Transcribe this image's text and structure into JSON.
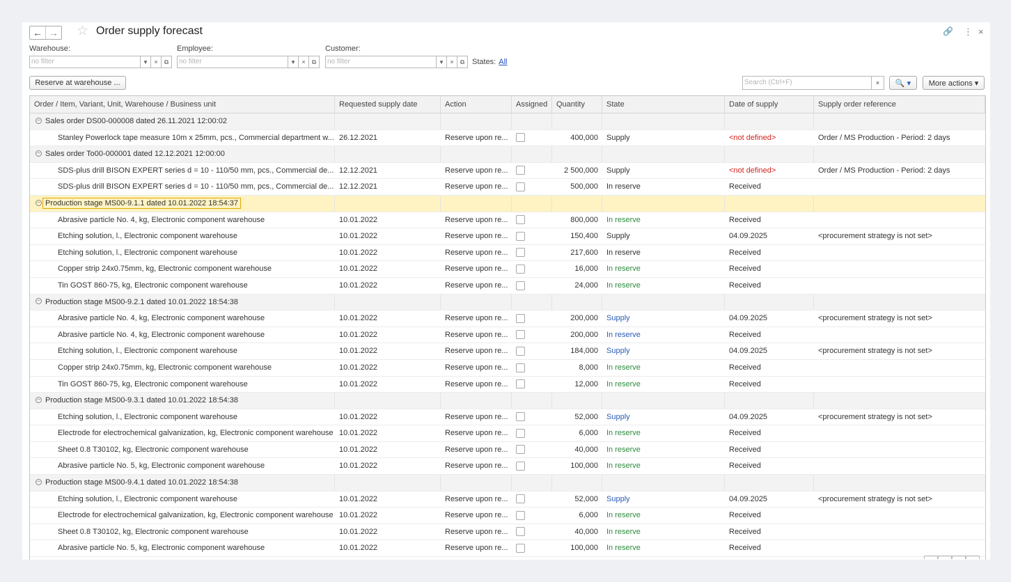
{
  "window": {
    "title": "Order supply forecast",
    "back_glyph": "←",
    "forward_glyph": "→",
    "star_glyph": "☆",
    "link_glyph": "🔗",
    "more_glyph": "⋮",
    "close_glyph": "×"
  },
  "filters": {
    "warehouse": {
      "label": "Warehouse:",
      "placeholder": "no filter"
    },
    "employee": {
      "label": "Employee:",
      "placeholder": "no filter"
    },
    "customer": {
      "label": "Customer:",
      "placeholder": "no filter"
    },
    "dropdown_glyph": "▾",
    "clear_glyph": "×",
    "open_glyph": "⧉",
    "states_label": "States:",
    "states_value": "All"
  },
  "toolbar": {
    "reserve_button": "Reserve at warehouse ...",
    "search_placeholder": "Search (Ctrl+F)",
    "search_clear": "×",
    "search_button": "🔍 ▾",
    "more_actions": "More actions ▾"
  },
  "columns": [
    "Order / Item, Variant, Unit, Warehouse / Business unit",
    "Requested supply date",
    "Action",
    "Assigned",
    "Quantity",
    "State",
    "Date of supply",
    "Supply order reference"
  ],
  "groups": [
    {
      "title": "Sales order DS00-000008 dated 26.11.2021 12:00:02",
      "selected": false,
      "rows": [
        {
          "item": "Stanley Powerlock tape measure 10m x 25mm, pcs., Commercial department w...",
          "date": "26.12.2021",
          "action": "Reserve upon re...",
          "qty": "400,000",
          "state": "Supply",
          "state_style": "def",
          "supply_date": "<not defined>",
          "supply_red": true,
          "ref": "Order / MS Production - Period: 2 days"
        }
      ]
    },
    {
      "title": "Sales order To00-000001 dated 12.12.2021 12:00:00",
      "selected": false,
      "rows": [
        {
          "item": "SDS-plus drill BISON EXPERT series d = 10 - 110/50 mm, pcs., Commercial de...",
          "date": "12.12.2021",
          "action": "Reserve upon re...",
          "qty": "2 500,000",
          "state": "Supply",
          "state_style": "def",
          "supply_date": "<not defined>",
          "supply_red": true,
          "ref": "Order / MS Production - Period: 2 days"
        },
        {
          "item": "SDS-plus drill BISON EXPERT series d = 10 - 110/50 mm, pcs., Commercial de...",
          "date": "12.12.2021",
          "action": "Reserve upon re...",
          "qty": "500,000",
          "state": "In reserve",
          "state_style": "def",
          "supply_date": "Received",
          "supply_red": false,
          "ref": ""
        }
      ]
    },
    {
      "title": "Production stage MS00-9.1.1 dated 10.01.2022 18:54:37",
      "selected": true,
      "rows": [
        {
          "item": "Abrasive particle No. 4, kg, Electronic component warehouse",
          "date": "10.01.2022",
          "action": "Reserve upon re...",
          "qty": "800,000",
          "state": "In reserve",
          "state_style": "green",
          "supply_date": "Received",
          "supply_red": false,
          "ref": ""
        },
        {
          "item": "Etching solution, l., Electronic component warehouse",
          "date": "10.01.2022",
          "action": "Reserve upon re...",
          "qty": "150,400",
          "state": "Supply",
          "state_style": "def",
          "supply_date": "04.09.2025",
          "supply_red": false,
          "ref": "<procurement strategy is not set>"
        },
        {
          "item": "Etching solution, l., Electronic component warehouse",
          "date": "10.01.2022",
          "action": "Reserve upon re...",
          "qty": "217,600",
          "state": "In reserve",
          "state_style": "def",
          "supply_date": "Received",
          "supply_red": false,
          "ref": ""
        },
        {
          "item": "Copper strip 24x0.75mm, kg, Electronic component warehouse",
          "date": "10.01.2022",
          "action": "Reserve upon re...",
          "qty": "16,000",
          "state": "In reserve",
          "state_style": "green",
          "supply_date": "Received",
          "supply_red": false,
          "ref": ""
        },
        {
          "item": "Tin GOST 860-75, kg, Electronic component warehouse",
          "date": "10.01.2022",
          "action": "Reserve upon re...",
          "qty": "24,000",
          "state": "In reserve",
          "state_style": "green",
          "supply_date": "Received",
          "supply_red": false,
          "ref": ""
        }
      ]
    },
    {
      "title": "Production stage MS00-9.2.1 dated 10.01.2022 18:54:38",
      "selected": false,
      "rows": [
        {
          "item": "Abrasive particle No. 4, kg, Electronic component warehouse",
          "date": "10.01.2022",
          "action": "Reserve upon re...",
          "qty": "200,000",
          "state": "Supply",
          "state_style": "blue",
          "supply_date": "04.09.2025",
          "supply_red": false,
          "ref": "<procurement strategy is not set>"
        },
        {
          "item": "Abrasive particle No. 4, kg, Electronic component warehouse",
          "date": "10.01.2022",
          "action": "Reserve upon re...",
          "qty": "200,000",
          "state": "In reserve",
          "state_style": "blue",
          "supply_date": "Received",
          "supply_red": false,
          "ref": ""
        },
        {
          "item": "Etching solution, l., Electronic component warehouse",
          "date": "10.01.2022",
          "action": "Reserve upon re...",
          "qty": "184,000",
          "state": "Supply",
          "state_style": "blue",
          "supply_date": "04.09.2025",
          "supply_red": false,
          "ref": "<procurement strategy is not set>"
        },
        {
          "item": "Copper strip 24x0.75mm, kg, Electronic component warehouse",
          "date": "10.01.2022",
          "action": "Reserve upon re...",
          "qty": "8,000",
          "state": "In reserve",
          "state_style": "green",
          "supply_date": "Received",
          "supply_red": false,
          "ref": ""
        },
        {
          "item": "Tin GOST 860-75, kg, Electronic component warehouse",
          "date": "10.01.2022",
          "action": "Reserve upon re...",
          "qty": "12,000",
          "state": "In reserve",
          "state_style": "green",
          "supply_date": "Received",
          "supply_red": false,
          "ref": ""
        }
      ]
    },
    {
      "title": "Production stage MS00-9.3.1 dated 10.01.2022 18:54:38",
      "selected": false,
      "rows": [
        {
          "item": "Etching solution, l., Electronic component warehouse",
          "date": "10.01.2022",
          "action": "Reserve upon re...",
          "qty": "52,000",
          "state": "Supply",
          "state_style": "blue",
          "supply_date": "04.09.2025",
          "supply_red": false,
          "ref": "<procurement strategy is not set>"
        },
        {
          "item": "Electrode for electrochemical galvanization, kg, Electronic component warehouse",
          "date": "10.01.2022",
          "action": "Reserve upon re...",
          "qty": "6,000",
          "state": "In reserve",
          "state_style": "green",
          "supply_date": "Received",
          "supply_red": false,
          "ref": ""
        },
        {
          "item": "Sheet 0.8 T30102, kg, Electronic component warehouse",
          "date": "10.01.2022",
          "action": "Reserve upon re...",
          "qty": "40,000",
          "state": "In reserve",
          "state_style": "green",
          "supply_date": "Received",
          "supply_red": false,
          "ref": ""
        },
        {
          "item": "Abrasive particle No. 5, kg, Electronic component warehouse",
          "date": "10.01.2022",
          "action": "Reserve upon re...",
          "qty": "100,000",
          "state": "In reserve",
          "state_style": "green",
          "supply_date": "Received",
          "supply_red": false,
          "ref": ""
        }
      ]
    },
    {
      "title": "Production stage MS00-9.4.1 dated 10.01.2022 18:54:38",
      "selected": false,
      "rows": [
        {
          "item": "Etching solution, l., Electronic component warehouse",
          "date": "10.01.2022",
          "action": "Reserve upon re...",
          "qty": "52,000",
          "state": "Supply",
          "state_style": "blue",
          "supply_date": "04.09.2025",
          "supply_red": false,
          "ref": "<procurement strategy is not set>"
        },
        {
          "item": "Electrode for electrochemical galvanization, kg, Electronic component warehouse",
          "date": "10.01.2022",
          "action": "Reserve upon re...",
          "qty": "6,000",
          "state": "In reserve",
          "state_style": "green",
          "supply_date": "Received",
          "supply_red": false,
          "ref": ""
        },
        {
          "item": "Sheet 0.8 T30102, kg, Electronic component warehouse",
          "date": "10.01.2022",
          "action": "Reserve upon re...",
          "qty": "40,000",
          "state": "In reserve",
          "state_style": "green",
          "supply_date": "Received",
          "supply_red": false,
          "ref": ""
        },
        {
          "item": "Abrasive particle No. 5, kg, Electronic component warehouse",
          "date": "10.01.2022",
          "action": "Reserve upon re...",
          "qty": "100,000",
          "state": "In reserve",
          "state_style": "green",
          "supply_date": "Received",
          "supply_red": false,
          "ref": ""
        }
      ]
    }
  ],
  "colors": {
    "selected_row": "#fff3c4",
    "selection_border": "#e0a800",
    "state_green": "#2e8b3f",
    "state_blue": "#2b5bb5",
    "not_defined_red": "#d0261f"
  }
}
